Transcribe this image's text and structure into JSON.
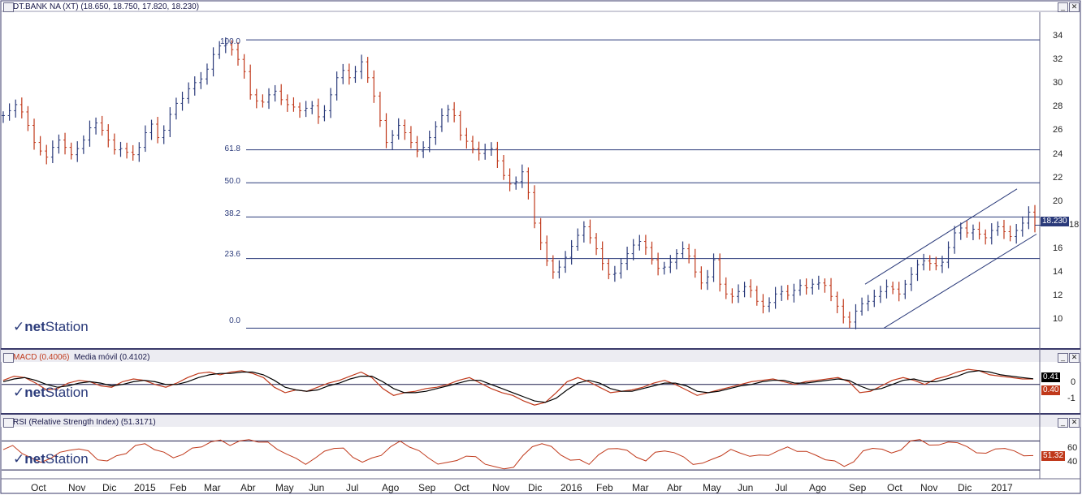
{
  "colors": {
    "frame": "#3a3a6a",
    "price": "#2a3a7a",
    "down": "#c0391b",
    "macd": "#000000",
    "signal": "#c0391b",
    "rsi": "#c0391b"
  },
  "main": {
    "title": "DT.BANK NA (XT) (18.650, 18.750, 17.820, 18.230)",
    "last_value": "18.230",
    "yticks": [
      "34",
      "32",
      "30",
      "28",
      "26",
      "24",
      "22",
      "20",
      "18",
      "16",
      "14",
      "12",
      "10"
    ],
    "fib_levels": [
      "100.0",
      "61.8",
      "50.0",
      "38.2",
      "23.6",
      "0.0"
    ]
  },
  "macd": {
    "title": "MACD (0.4006)",
    "subtitle": "Media móvil (0.4102)",
    "yticks": [
      "0",
      "-1"
    ],
    "badge_signal": "0.41",
    "badge_macd": "0.40"
  },
  "rsi": {
    "title": "RSI (Relative Strength Index) (51.3171)",
    "yticks": [
      "60",
      "40"
    ],
    "badge": "51.32"
  },
  "logo": {
    "net": "net",
    "station": "Station"
  },
  "buttons": {
    "min": "_",
    "close": "✕"
  },
  "xaxis": [
    "Oct",
    "Nov",
    "Dic",
    "2015",
    "Feb",
    "Mar",
    "Abr",
    "May",
    "Jun",
    "Jul",
    "Ago",
    "Sep",
    "Oct",
    "Nov",
    "Dic",
    "2016",
    "Feb",
    "Mar",
    "Abr",
    "May",
    "Jun",
    "Jul",
    "Ago",
    "Sep",
    "Oct",
    "Nov",
    "Dic",
    "2017"
  ],
  "chart_data": [
    {
      "type": "line",
      "title": "DT.BANK NA (XT)",
      "series": [
        {
          "name": "DT.BANK NA (XT)",
          "values": [
            27.2,
            27.6,
            28.1,
            27.5,
            26.4,
            25.0,
            24.3,
            23.8,
            24.6,
            25.2,
            24.6,
            24.0,
            24.5,
            25.2,
            26.2,
            26.6,
            26.0,
            25.2,
            24.4,
            24.5,
            24.2,
            24.0,
            24.6,
            25.8,
            26.5,
            25.4,
            26.0,
            27.3,
            28.2,
            28.6,
            29.4,
            29.9,
            30.2,
            31.0,
            32.2,
            32.9,
            33.0,
            32.6,
            31.8,
            30.8,
            28.9,
            28.4,
            28.3,
            28.9,
            29.2,
            28.5,
            28.1,
            27.9,
            27.6,
            27.8,
            28.0,
            27.1,
            27.6,
            28.9,
            30.3,
            30.9,
            30.3,
            30.8,
            31.6,
            30.3,
            28.8,
            26.8,
            25.0,
            25.6,
            26.4,
            25.8,
            25.0,
            24.3,
            24.6,
            25.4,
            26.3,
            27.2,
            27.7,
            27.2,
            25.6,
            25.1,
            24.5,
            24.1,
            24.4,
            24.5,
            23.5,
            22.3,
            21.6,
            21.8,
            22.6,
            20.9,
            18.4,
            16.8,
            15.3,
            14.4,
            14.8,
            15.6,
            16.5,
            17.4,
            18.1,
            17.2,
            16.3,
            15.1,
            14.2,
            14.3,
            15.1,
            15.9,
            16.6,
            16.9,
            16.4,
            15.4,
            14.7,
            14.8,
            15.2,
            15.9,
            16.3,
            15.7,
            14.4,
            13.5,
            14.0,
            15.4,
            13.4,
            12.6,
            12.4,
            12.8,
            13.2,
            12.9,
            12.0,
            11.6,
            11.9,
            12.6,
            12.8,
            12.5,
            12.9,
            13.3,
            13.1,
            13.4,
            13.5,
            13.3,
            12.4,
            11.6,
            10.7,
            10.3,
            11.2,
            11.8,
            12.0,
            12.4,
            12.8,
            13.2,
            13.0,
            12.6,
            13.4,
            14.2,
            15.0,
            15.3,
            15.1,
            14.9,
            15.2,
            16.4,
            17.6,
            18.0,
            17.6,
            17.9,
            17.5,
            17.2,
            17.8,
            18.1,
            17.7,
            17.3,
            17.8,
            18.4,
            19.3,
            18.23
          ]
        }
      ],
      "yticks": [
        10,
        12,
        14,
        16,
        18,
        20,
        22,
        24,
        26,
        28,
        30,
        32,
        34
      ],
      "ylim": [
        8.5,
        35.2
      ],
      "fibonacci": [
        {
          "label": "100.0",
          "value": 33.4
        },
        {
          "label": "61.8",
          "value": 24.4
        },
        {
          "label": "50.0",
          "value": 21.7
        },
        {
          "label": "38.2",
          "value": 18.9
        },
        {
          "label": "23.6",
          "value": 15.5
        },
        {
          "label": "0.0",
          "value": 9.8
        }
      ],
      "last": 18.23
    },
    {
      "type": "line",
      "title": "MACD (0.4006)",
      "series": [
        {
          "name": "MACD",
          "values": [
            0.3,
            0.6,
            0.5,
            0.1,
            -0.4,
            -0.3,
            0.1,
            0.3,
            0.2,
            -0.1,
            -0.2,
            0.2,
            0.4,
            0.3,
            0.0,
            -0.2,
            0.1,
            0.5,
            0.8,
            0.9,
            0.7,
            0.9,
            1.0,
            0.8,
            0.5,
            -0.2,
            -0.6,
            -0.4,
            -0.5,
            -0.2,
            0.1,
            0.3,
            0.6,
            0.9,
            0.5,
            -0.3,
            -0.8,
            -0.6,
            -0.5,
            -0.3,
            -0.2,
            0.0,
            0.3,
            0.5,
            0.1,
            -0.3,
            -0.6,
            -0.8,
            -1.2,
            -1.5,
            -1.3,
            -0.6,
            0.2,
            0.5,
            0.2,
            -0.2,
            -0.6,
            -0.5,
            -0.4,
            -0.2,
            0.1,
            0.3,
            0.0,
            -0.4,
            -0.8,
            -0.6,
            -0.4,
            -0.2,
            0.0,
            0.2,
            0.3,
            0.4,
            0.2,
            0.0,
            0.2,
            0.3,
            0.4,
            0.5,
            0.2,
            -0.6,
            -0.5,
            -0.1,
            0.3,
            0.5,
            0.3,
            0.0,
            0.4,
            0.6,
            0.9,
            1.1,
            1.0,
            0.7,
            0.6,
            0.5,
            0.4,
            0.4
          ]
        },
        {
          "name": "Media móvil",
          "values": [
            0.2,
            0.4,
            0.5,
            0.3,
            0.0,
            -0.2,
            -0.1,
            0.1,
            0.2,
            0.1,
            -0.1,
            0.0,
            0.2,
            0.3,
            0.2,
            0.0,
            0.0,
            0.2,
            0.5,
            0.7,
            0.8,
            0.8,
            0.9,
            0.9,
            0.7,
            0.3,
            -0.2,
            -0.4,
            -0.5,
            -0.4,
            -0.1,
            0.1,
            0.4,
            0.6,
            0.6,
            0.2,
            -0.3,
            -0.6,
            -0.6,
            -0.5,
            -0.3,
            -0.1,
            0.1,
            0.3,
            0.3,
            0.0,
            -0.3,
            -0.6,
            -0.9,
            -1.2,
            -1.3,
            -1.0,
            -0.4,
            0.1,
            0.3,
            0.1,
            -0.3,
            -0.5,
            -0.5,
            -0.3,
            -0.1,
            0.1,
            0.1,
            -0.1,
            -0.5,
            -0.6,
            -0.5,
            -0.3,
            -0.1,
            0.0,
            0.2,
            0.3,
            0.3,
            0.1,
            0.1,
            0.2,
            0.3,
            0.4,
            0.3,
            -0.1,
            -0.4,
            -0.3,
            0.0,
            0.3,
            0.4,
            0.2,
            0.2,
            0.4,
            0.6,
            0.9,
            1.0,
            0.9,
            0.7,
            0.6,
            0.5,
            0.41
          ]
        }
      ],
      "yticks": [
        0,
        -1
      ],
      "ylim": [
        -1.9,
        1.4
      ]
    },
    {
      "type": "line",
      "title": "RSI (Relative Strength Index) (51.3171)",
      "series": [
        {
          "name": "RSI",
          "values": [
            58,
            62,
            55,
            45,
            40,
            48,
            52,
            58,
            60,
            54,
            46,
            42,
            48,
            55,
            62,
            66,
            60,
            52,
            48,
            52,
            58,
            64,
            68,
            70,
            66,
            68,
            72,
            70,
            66,
            60,
            52,
            44,
            40,
            45,
            55,
            62,
            58,
            48,
            42,
            44,
            52,
            62,
            68,
            64,
            55,
            46,
            40,
            38,
            44,
            50,
            46,
            40,
            34,
            30,
            36,
            48,
            62,
            68,
            60,
            52,
            44,
            42,
            40,
            50,
            58,
            62,
            55,
            48,
            44,
            52,
            58,
            54,
            46,
            40,
            38,
            44,
            52,
            56,
            54,
            50,
            48,
            52,
            56,
            60,
            58,
            54,
            50,
            46,
            40,
            36,
            42,
            54,
            62,
            58,
            52,
            60,
            68,
            72,
            66,
            62,
            70,
            68,
            60,
            56,
            52,
            58,
            62,
            54,
            50,
            51.32
          ]
        }
      ],
      "yticks": [
        40,
        60
      ],
      "ylim": [
        20,
        85
      ]
    }
  ]
}
